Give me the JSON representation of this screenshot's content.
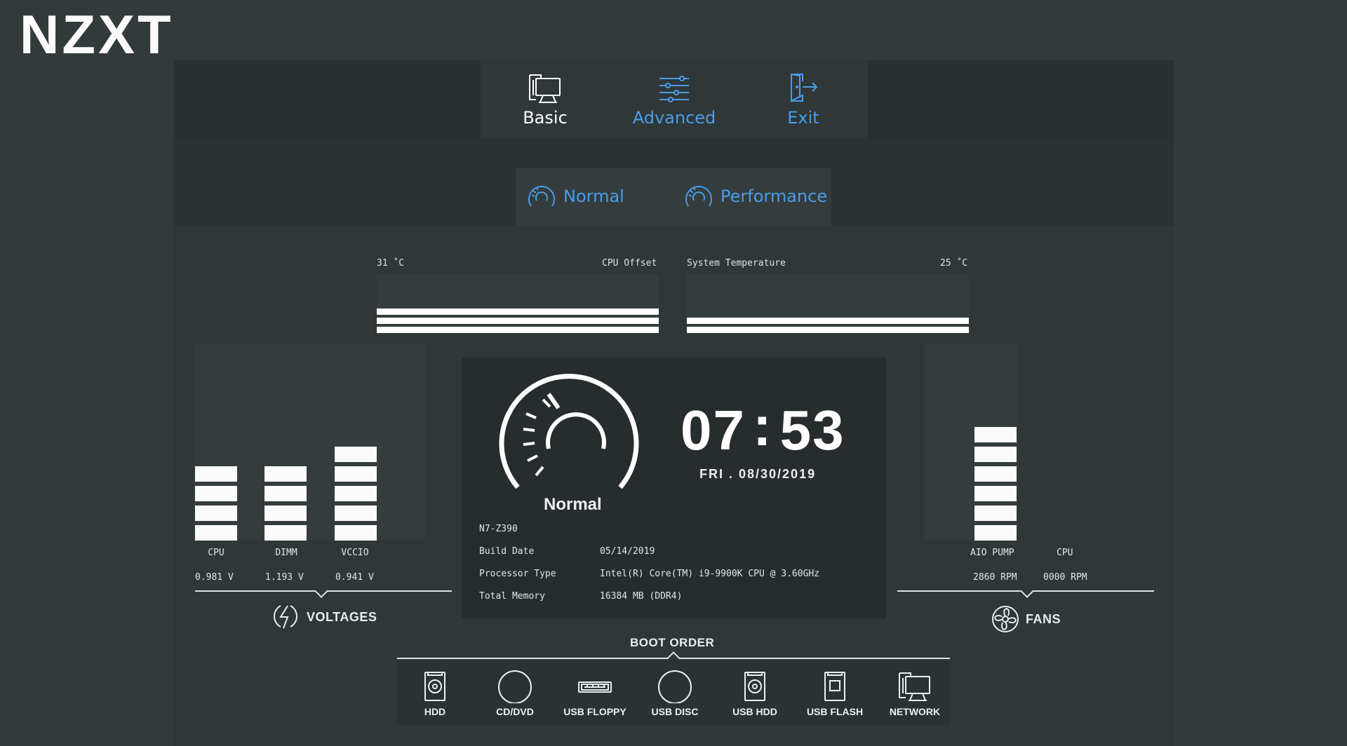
{
  "brand": {
    "logo": "NZXT"
  },
  "nav": [
    {
      "label": "Basic",
      "icon": "monitor-icon",
      "active": true,
      "color": "#ffffff"
    },
    {
      "label": "Advanced",
      "icon": "sliders-icon",
      "active": false,
      "color": "#4a9de8"
    },
    {
      "label": "Exit",
      "icon": "exit-door-icon",
      "active": false,
      "color": "#4a9de8"
    }
  ],
  "modes": [
    {
      "label": "Normal",
      "icon": "gauge-icon"
    },
    {
      "label": "Performance",
      "icon": "gauge-icon"
    }
  ],
  "accent_color": "#4a9de8",
  "temps": {
    "cpu": {
      "value": "31 ˚C",
      "label": "CPU Offset"
    },
    "system": {
      "label": "System Temperature",
      "value": "25 ˚C"
    }
  },
  "voltages": {
    "title": "VOLTAGES",
    "icon": "lightning-icon",
    "items": [
      {
        "name": "CPU",
        "value": "0.981 V",
        "level": 4
      },
      {
        "name": "DIMM",
        "value": "1.193 V",
        "level": 4
      },
      {
        "name": "VCCIO",
        "value": "0.941 V",
        "level": 5
      }
    ]
  },
  "fans": {
    "title": "FANS",
    "icon": "fan-icon",
    "items": [
      {
        "name": "AIO PUMP",
        "value": "2860 RPM",
        "level": 6
      },
      {
        "name": "CPU",
        "value": "0000 RPM",
        "level": 0
      }
    ]
  },
  "center": {
    "mode_label": "Normal",
    "time_hours": "07",
    "time_minutes": "53",
    "date": "FRI . 08/30/2019",
    "model": "N7-Z390",
    "info": [
      {
        "key": "Build Date",
        "value": "05/14/2019"
      },
      {
        "key": "Processor Type",
        "value": "Intel(R) Core(TM) i9-9900K CPU @ 3.60GHz"
      },
      {
        "key": "Total Memory",
        "value": "16384 MB (DDR4)"
      }
    ]
  },
  "boot": {
    "title": "BOOT ORDER",
    "items": [
      {
        "label": "HDD",
        "icon": "hdd-icon"
      },
      {
        "label": "CD/DVD",
        "icon": "disc-icon"
      },
      {
        "label": "USB FLOPPY",
        "icon": "usb-floppy-icon"
      },
      {
        "label": "USB DISC",
        "icon": "disc-icon"
      },
      {
        "label": "USB HDD",
        "icon": "usb-hdd-icon"
      },
      {
        "label": "USB FLASH",
        "icon": "usb-flash-icon"
      },
      {
        "label": "NETWORK",
        "icon": "network-icon"
      }
    ]
  }
}
